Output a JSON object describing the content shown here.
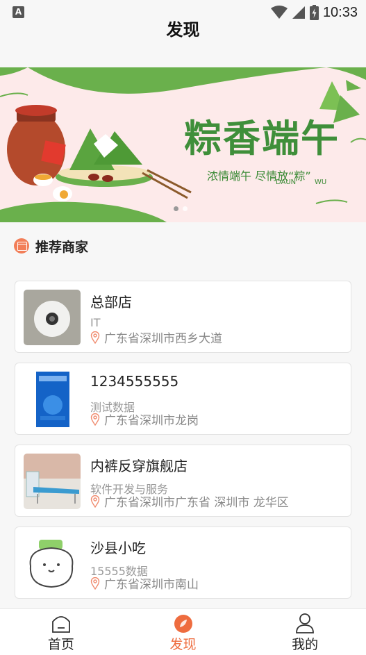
{
  "status_bar": {
    "time": "10:33",
    "left_icon": "A",
    "icons": [
      "wifi-icon",
      "signal-icon",
      "battery-icon"
    ]
  },
  "header": {
    "title": "发现"
  },
  "banner": {
    "title": "粽香端午",
    "subtitle": "浓情端午 尽情放“粽”",
    "label_daun": "DAUN",
    "label_wu": "WU",
    "slide_count": 2,
    "active_slide": 0
  },
  "section": {
    "title": "推荐商家",
    "icon": "shop-icon"
  },
  "stores": [
    {
      "name": "总部店",
      "category": "IT",
      "address": "广东省深圳市西乡大道",
      "thumb": "smoke-detector"
    },
    {
      "name": "1234555555",
      "category": "测试数据",
      "address": "广东省深圳市龙岗",
      "thumb": "book-cover"
    },
    {
      "name": "内裤反穿旗舰店",
      "category": "软件开发与服务",
      "address": "广东省深圳市广东省 深圳市 龙华区",
      "thumb": "folding-bed"
    },
    {
      "name": "沙县小吃",
      "category": "15555数据",
      "address": "广东省深圳市南山",
      "thumb": "cartoon-sticker"
    }
  ],
  "tabs": [
    {
      "label": "首页",
      "icon": "home-icon",
      "active": false
    },
    {
      "label": "发现",
      "icon": "discover-icon",
      "active": true
    },
    {
      "label": "我的",
      "icon": "profile-icon",
      "active": false
    }
  ],
  "colors": {
    "accent": "#ee6c3f",
    "banner_green": "#3f8f3a",
    "banner_bg": "#fdeaea"
  }
}
